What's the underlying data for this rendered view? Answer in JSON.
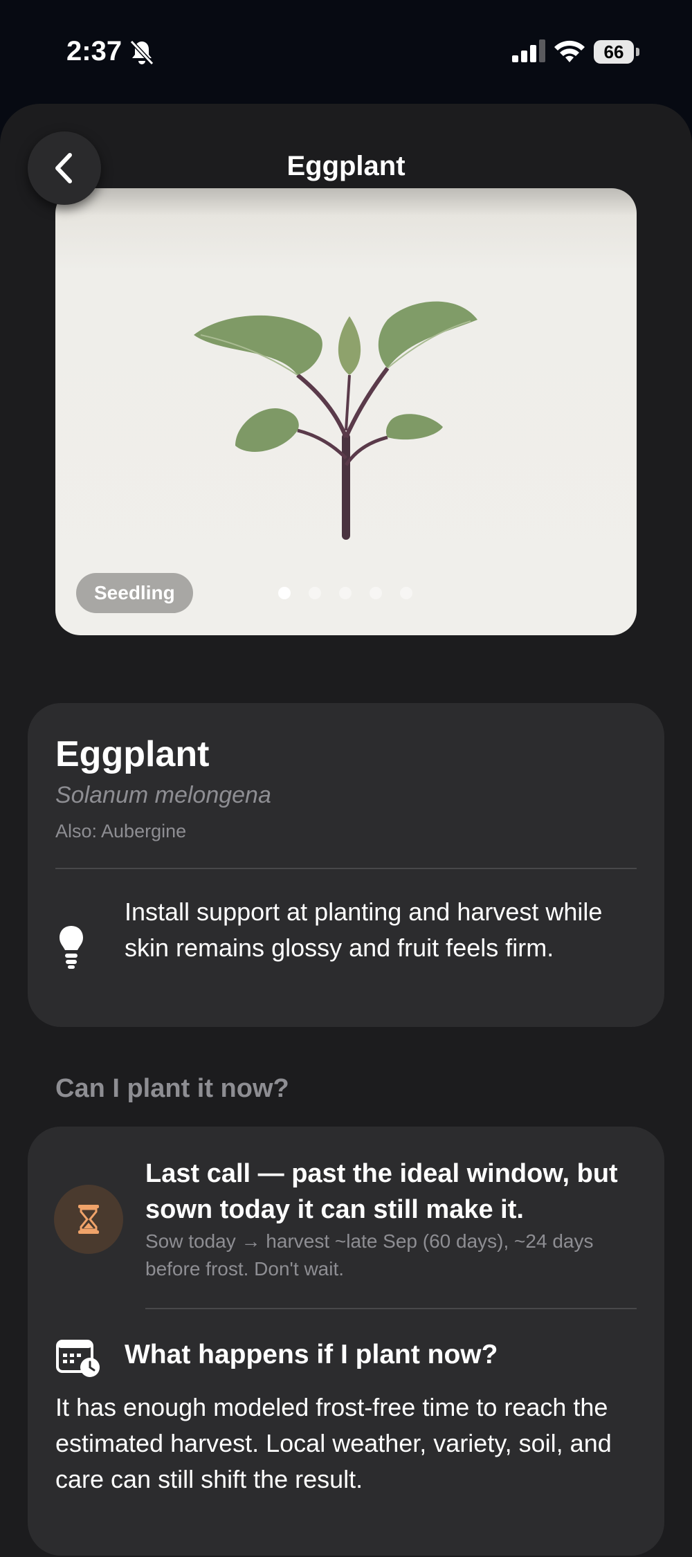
{
  "status_bar": {
    "time": "2:37",
    "battery": "66"
  },
  "nav": {
    "title": "Eggplant",
    "back_icon": "chevron-left-icon"
  },
  "gallery": {
    "stage_label": "Seedling",
    "dot_count": 5,
    "active_dot": 0
  },
  "plant": {
    "name": "Eggplant",
    "scientific_name": "Solanum melongena",
    "also_known_as": "Also: Aubergine",
    "tip": "Install support at planting and harvest while skin remains glossy and fruit feels firm."
  },
  "plant_now": {
    "section_title": "Can I plant it now?",
    "headline": "Last call — past the ideal window, but sown today it can still make it.",
    "subtext": "Sow today → harvest ~late Sep (60 days), ~24 days before frost. Don't wait.",
    "what_happens_title": "What happens if I plant now?",
    "what_happens_text": "It has enough modeled frost-free time to reach the estimated harvest. Local weather, variety, soil, and care can still shift the result."
  },
  "colors": {
    "warning_accent": "#f0a36a",
    "card_bg": "#2c2c2e",
    "sheet_bg": "#1c1c1e"
  }
}
